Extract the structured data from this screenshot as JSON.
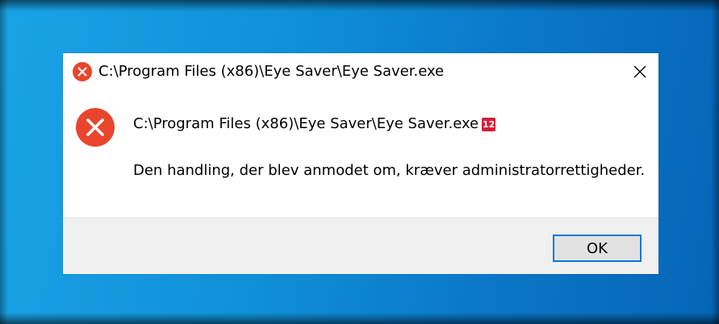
{
  "dialog": {
    "title": "C:\\Program Files (x86)\\Eye Saver\\Eye Saver.exe",
    "path": "C:\\Program Files (x86)\\Eye Saver\\Eye Saver.exe",
    "badge": "12",
    "message": "Den handling, der blev anmodet om, kræver administratorrettigheder.",
    "ok_label": "OK",
    "title_icon": "error-icon",
    "message_icon": "error-icon",
    "close_icon": "close-icon"
  },
  "colors": {
    "desktop": "#0f8fd8",
    "error": "#e9452d",
    "badge": "#d21f3c",
    "focus_border": "#0078d7",
    "footer": "#f0f0f0"
  }
}
